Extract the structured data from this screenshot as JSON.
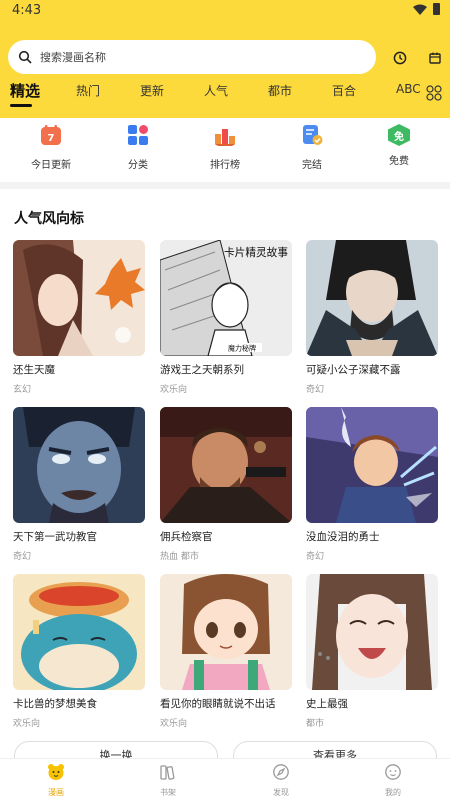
{
  "status": {
    "time": "4:43"
  },
  "search": {
    "placeholder": "搜索漫画名称"
  },
  "tabs": [
    "精选",
    "热门",
    "更新",
    "人气",
    "都市",
    "百合",
    "ABC"
  ],
  "quick_links": [
    {
      "label": "今日更新",
      "icon": "calendar-icon",
      "color": "#F2704B"
    },
    {
      "label": "分类",
      "icon": "category-grid-icon",
      "color": "#3B7BF0"
    },
    {
      "label": "排行榜",
      "icon": "ranking-icon",
      "color": "#F0903B"
    },
    {
      "label": "完结",
      "icon": "finished-check-icon",
      "color": "#4C8BF0"
    },
    {
      "label": "免费",
      "icon": "free-badge-icon",
      "color": "#3DBA62"
    }
  ],
  "free_badge_text": "免",
  "section": {
    "title": "人气风向标"
  },
  "comics": [
    {
      "title": "还生天魔",
      "genre": "玄幻"
    },
    {
      "title": "游戏王之天朝系列",
      "genre": "欢乐向"
    },
    {
      "title": "可疑小公子深藏不露",
      "genre": "奇幻"
    },
    {
      "title": "天下第一武功教官",
      "genre": "奇幻"
    },
    {
      "title": "佣兵检察官",
      "genre": "热血  都市"
    },
    {
      "title": "没血没泪的勇士",
      "genre": "奇幻"
    },
    {
      "title": "卡比兽的梦想美食",
      "genre": "欢乐向"
    },
    {
      "title": "看见你的眼睛就说不出话",
      "genre": "欢乐向"
    },
    {
      "title": "史上最强",
      "genre": "都市"
    }
  ],
  "cover_texts": {
    "comic2_title": "卡片精灵故事",
    "comic2_author": "魔力秘牌"
  },
  "buttons": {
    "refresh": "换一换",
    "more": "查看更多"
  },
  "bottom_nav": [
    {
      "label": "漫画",
      "icon": "comic-bear-icon"
    },
    {
      "label": "书架",
      "icon": "bookshelf-icon"
    },
    {
      "label": "发现",
      "icon": "compass-icon"
    },
    {
      "label": "我的",
      "icon": "profile-face-icon"
    }
  ],
  "colors": {
    "brand_yellow": "#FDDA3C",
    "active_nav": "#E9A800"
  }
}
